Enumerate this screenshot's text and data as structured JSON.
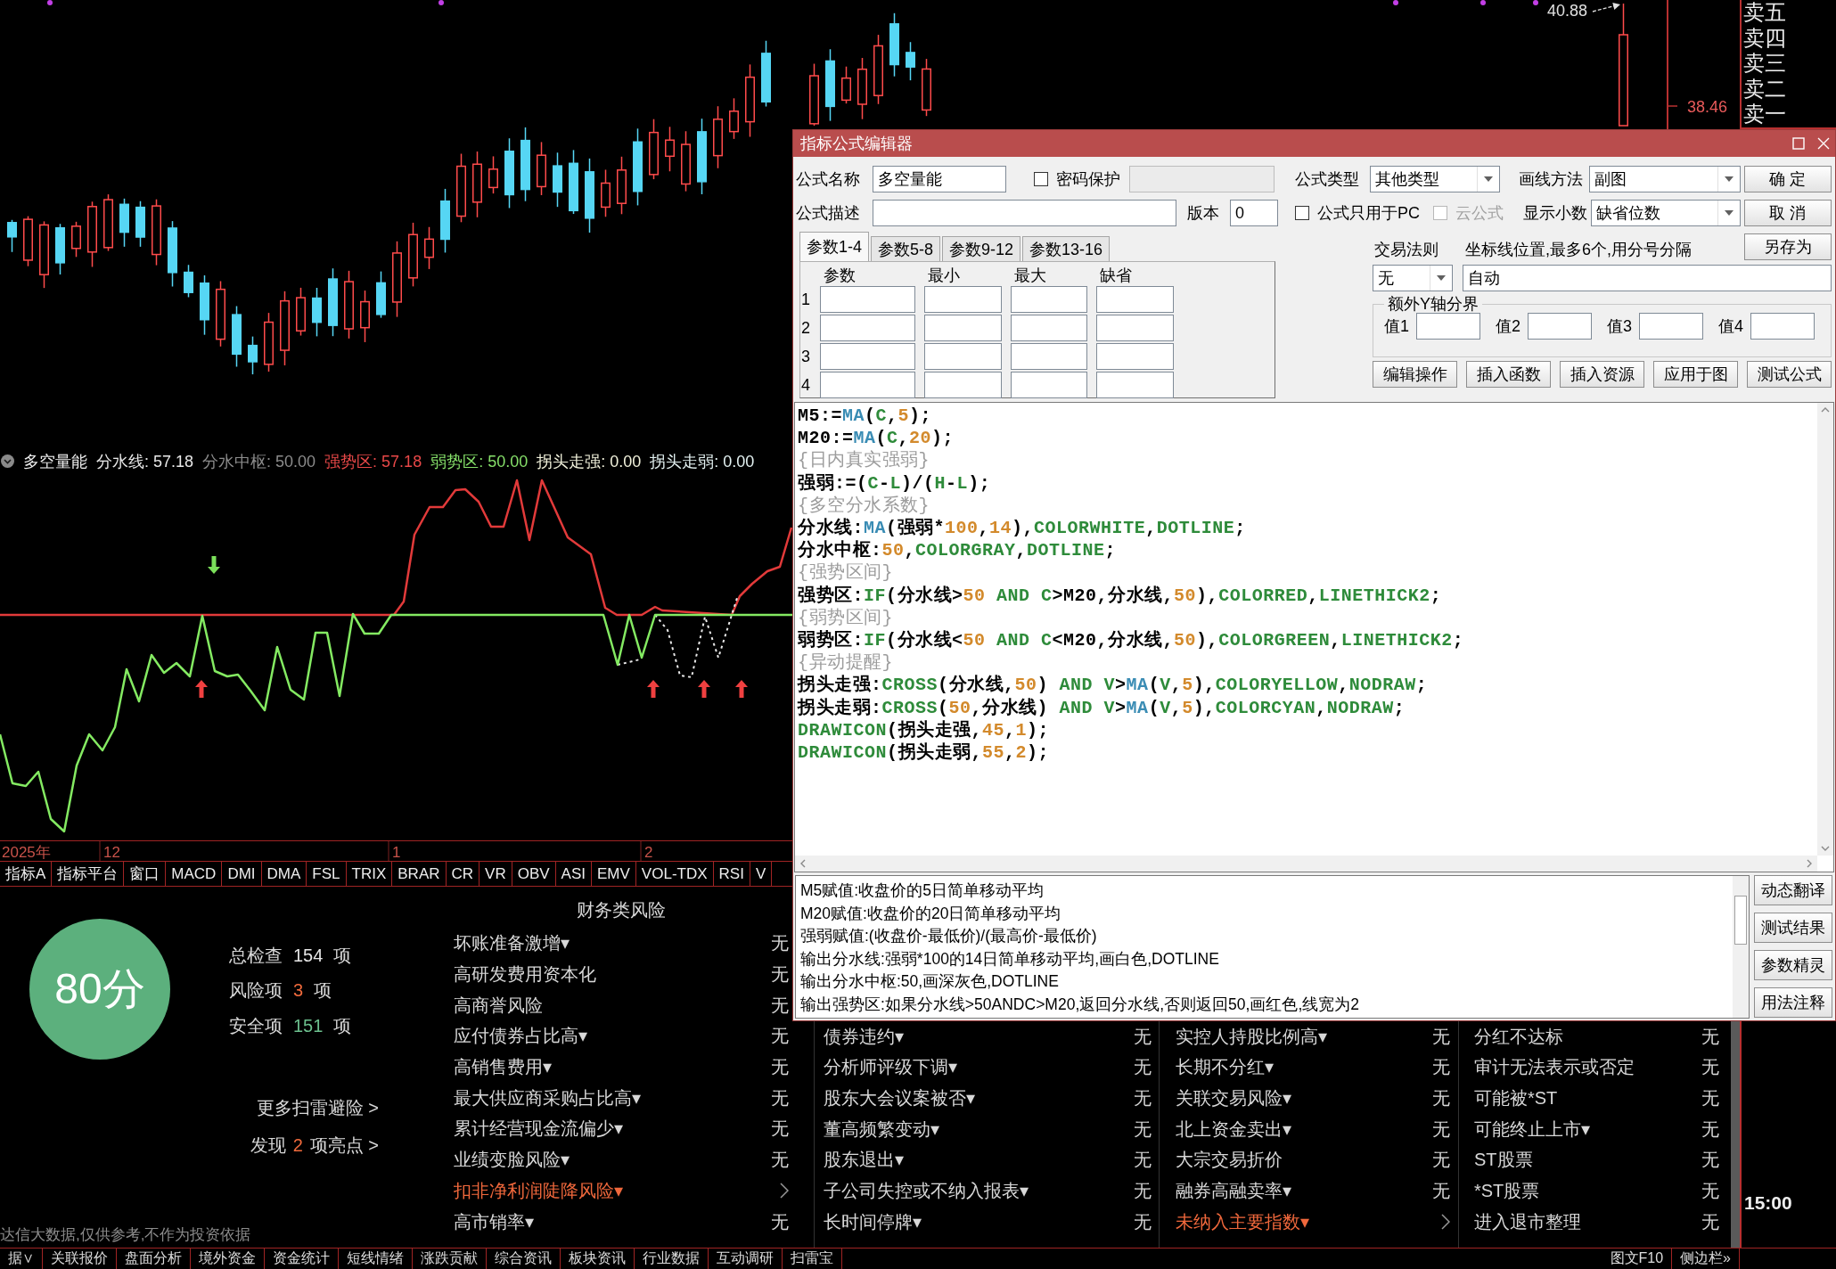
{
  "main_chart": {
    "high_label": "40.88",
    "axis_label": "38.46"
  },
  "order_book": [
    "卖五",
    "卖四",
    "卖三",
    "卖二",
    "卖一"
  ],
  "indicator": {
    "name": "多空量能",
    "outputs": [
      {
        "text": "分水线: 57.18",
        "color": "#e8e8e8"
      },
      {
        "text": "分水中枢: 50.00",
        "color": "#8c8c8c"
      },
      {
        "text": "强势区: 57.18",
        "color": "#e84848"
      },
      {
        "text": "弱势区: 50.00",
        "color": "#86e06a"
      },
      {
        "text": "拐头走强: 0.00",
        "color": "#f2f2dc"
      },
      {
        "text": "拐头走弱: 0.00",
        "color": "#e4f2f2"
      }
    ]
  },
  "time_axis": [
    "2025年",
    "12",
    "1",
    "2"
  ],
  "indicator_tabs": [
    "指标A",
    "指标平台",
    "窗口",
    "MACD",
    "DMI",
    "DMA",
    "FSL",
    "TRIX",
    "BRAR",
    "CR",
    "VR",
    "OBV",
    "ASI",
    "EMV",
    "VOL-TDX",
    "RSI",
    "V"
  ],
  "risk_panel": {
    "score": "80分",
    "stats": [
      {
        "label": "总检查",
        "count": "154",
        "unit": "项",
        "color": "#e6e6e6"
      },
      {
        "label": "风险项",
        "count": "3",
        "unit": "项",
        "color": "#f06a3c"
      },
      {
        "label": "安全项",
        "count": "151",
        "unit": "项",
        "color": "#6cc08e"
      }
    ],
    "links": [
      {
        "text": "更多扫雷避险 >"
      },
      {
        "text": "发现",
        "count": "2",
        "suffix": "项亮点 >"
      }
    ],
    "footer": "达信大数据,仅供参考,不作为投资依据",
    "columns": [
      {
        "title": "财务类风险",
        "items": [
          {
            "label": "坏账准备激增▾",
            "value": "无",
            "flagged": false
          },
          {
            "label": "高研发费用资本化",
            "value": "无",
            "flagged": false
          },
          {
            "label": "高商誉风险",
            "value": "无",
            "flagged": false
          },
          {
            "label": "应付债券占比高▾",
            "value": "无",
            "flagged": false
          },
          {
            "label": "高销售费用▾",
            "value": "无",
            "flagged": false
          },
          {
            "label": "最大供应商采购占比高▾",
            "value": "无",
            "flagged": false
          },
          {
            "label": "累计经营现金流偏少▾",
            "value": "无",
            "flagged": false
          },
          {
            "label": "业绩变脸风险▾",
            "value": "无",
            "flagged": false
          },
          {
            "label": "扣非净利润陡降风险▾",
            "flagged": true
          },
          {
            "label": "高市销率▾",
            "value": "无",
            "flagged": false
          }
        ]
      },
      {
        "items": [
          {
            "label": "债券违约▾",
            "value": "无",
            "flagged": false
          },
          {
            "label": "分析师评级下调▾",
            "value": "无",
            "flagged": false
          },
          {
            "label": "股东大会议案被否▾",
            "value": "无",
            "flagged": false
          },
          {
            "label": "董高频繁变动▾",
            "value": "无",
            "flagged": false
          },
          {
            "label": "股东退出▾",
            "value": "无",
            "flagged": false
          },
          {
            "label": "子公司失控或不纳入报表▾",
            "value": "无",
            "flagged": false
          },
          {
            "label": "长时间停牌▾",
            "value": "无",
            "flagged": false
          }
        ]
      },
      {
        "items": [
          {
            "label": "实控人持股比例高▾",
            "value": "无",
            "flagged": false
          },
          {
            "label": "长期不分红▾",
            "value": "无",
            "flagged": false
          },
          {
            "label": "关联交易风险▾",
            "value": "无",
            "flagged": false
          },
          {
            "label": "北上资金卖出▾",
            "value": "无",
            "flagged": false
          },
          {
            "label": "大宗交易折价",
            "value": "无",
            "flagged": false
          },
          {
            "label": "融券高融卖率▾",
            "value": "无",
            "flagged": false
          },
          {
            "label": "未纳入主要指数▾",
            "flagged": true
          }
        ]
      },
      {
        "items": [
          {
            "label": "分红不达标",
            "value": "无",
            "flagged": false
          },
          {
            "label": "审计无法表示或否定",
            "value": "无",
            "flagged": false
          },
          {
            "label": "可能被*ST",
            "value": "无",
            "flagged": false
          },
          {
            "label": "可能终止上市▾",
            "value": "无",
            "flagged": false
          },
          {
            "label": "ST股票",
            "value": "无",
            "flagged": false
          },
          {
            "label": "*ST股票",
            "value": "无",
            "flagged": false
          },
          {
            "label": "进入退市整理",
            "value": "无",
            "flagged": false
          }
        ]
      }
    ]
  },
  "side_panel": {
    "time": "15:00"
  },
  "bottom_tabs": [
    "据∨",
    "关联报价",
    "盘面分析",
    "境外资金",
    "资金统计",
    "短线情绪",
    "涨跌贡献",
    "综合资讯",
    "板块资讯",
    "行业数据",
    "互动调研",
    "扫雷宝"
  ],
  "bottom_right_tabs": [
    "图文F10",
    "侧边栏»"
  ],
  "dialog": {
    "title": "指标公式编辑器",
    "name_field": {
      "label": "公式名称",
      "value": "多空量能"
    },
    "password": {
      "label": "密码保护",
      "checked": false,
      "field_disabled": true
    },
    "formula_type": {
      "label": "公式类型",
      "value": "其他类型"
    },
    "draw_method": {
      "label": "画线方法",
      "value": "副图"
    },
    "description_field": {
      "label": "公式描述"
    },
    "version_field": {
      "label": "版本",
      "value": "0"
    },
    "options": [
      {
        "label": "公式只用于PC",
        "checked": false,
        "disabled": false
      },
      {
        "label": "云公式",
        "checked": false,
        "disabled": true
      }
    ],
    "decimals": {
      "label": "显示小数",
      "value": "缺省位数"
    },
    "buttons": [
      "确 定",
      "取 消",
      "另存为"
    ],
    "param_tabs": [
      {
        "label": "参数1-4",
        "selected": true
      },
      {
        "label": "参数5-8",
        "selected": false
      },
      {
        "label": "参数9-12",
        "selected": false
      },
      {
        "label": "参数13-16",
        "selected": false
      }
    ],
    "param_table": {
      "columns": [
        "参数",
        "最小",
        "最大",
        "缺省"
      ],
      "rows": [
        "1",
        "2",
        "3",
        "4"
      ]
    },
    "trade_rule": {
      "label": "交易法则",
      "value": "无"
    },
    "axis_lines": {
      "label": "坐标线位置,最多6个,用分号分隔",
      "value": "自动"
    },
    "y_bounds": {
      "title": "额外Y轴分界",
      "fields": [
        "值1",
        "值2",
        "值3",
        "值4"
      ]
    },
    "actions": [
      "编辑操作",
      "插入函数",
      "插入资源",
      "应用于图",
      "测试公式"
    ],
    "code": [
      [
        {
          "kind": "plain",
          "text": "M5:="
        },
        {
          "kind": "function",
          "text": "MA"
        },
        {
          "kind": "plain",
          "text": "("
        },
        {
          "kind": "keyword",
          "text": "C"
        },
        {
          "kind": "plain",
          "text": ","
        },
        {
          "kind": "number",
          "text": "5"
        },
        {
          "kind": "plain",
          "text": ");"
        }
      ],
      [
        {
          "kind": "plain",
          "text": "M20:="
        },
        {
          "kind": "function",
          "text": "MA"
        },
        {
          "kind": "plain",
          "text": "("
        },
        {
          "kind": "keyword",
          "text": "C"
        },
        {
          "kind": "plain",
          "text": ","
        },
        {
          "kind": "number",
          "text": "20"
        },
        {
          "kind": "plain",
          "text": ");"
        }
      ],
      [
        {
          "kind": "comment",
          "text": "{日内真实强弱}"
        }
      ],
      [
        {
          "kind": "plain",
          "text": "强弱:=("
        },
        {
          "kind": "keyword",
          "text": "C"
        },
        {
          "kind": "plain",
          "text": "-"
        },
        {
          "kind": "keyword",
          "text": "L"
        },
        {
          "kind": "plain",
          "text": ")/("
        },
        {
          "kind": "keyword",
          "text": "H"
        },
        {
          "kind": "plain",
          "text": "-"
        },
        {
          "kind": "keyword",
          "text": "L"
        },
        {
          "kind": "plain",
          "text": ");"
        }
      ],
      [
        {
          "kind": "comment",
          "text": "{多空分水系数}"
        }
      ],
      [
        {
          "kind": "plain",
          "text": "分水线:"
        },
        {
          "kind": "function",
          "text": "MA"
        },
        {
          "kind": "plain",
          "text": "(强弱*"
        },
        {
          "kind": "number",
          "text": "100"
        },
        {
          "kind": "plain",
          "text": ","
        },
        {
          "kind": "number",
          "text": "14"
        },
        {
          "kind": "plain",
          "text": "),"
        },
        {
          "kind": "keyword",
          "text": "COLORWHITE"
        },
        {
          "kind": "plain",
          "text": ","
        },
        {
          "kind": "keyword",
          "text": "DOTLINE"
        },
        {
          "kind": "plain",
          "text": ";"
        }
      ],
      [
        {
          "kind": "plain",
          "text": "分水中枢:"
        },
        {
          "kind": "number",
          "text": "50"
        },
        {
          "kind": "plain",
          "text": ","
        },
        {
          "kind": "keyword",
          "text": "COLORGRAY"
        },
        {
          "kind": "plain",
          "text": ","
        },
        {
          "kind": "keyword",
          "text": "DOTLINE"
        },
        {
          "kind": "plain",
          "text": ";"
        }
      ],
      [
        {
          "kind": "comment",
          "text": "{强势区间}"
        }
      ],
      [
        {
          "kind": "plain",
          "text": "强势区:"
        },
        {
          "kind": "keyword",
          "text": "IF"
        },
        {
          "kind": "plain",
          "text": "(分水线>"
        },
        {
          "kind": "number",
          "text": "50"
        },
        {
          "kind": "keyword",
          "text": " AND C"
        },
        {
          "kind": "plain",
          "text": ">M20,分水线,"
        },
        {
          "kind": "number",
          "text": "50"
        },
        {
          "kind": "plain",
          "text": "),"
        },
        {
          "kind": "keyword",
          "text": "COLORRED"
        },
        {
          "kind": "plain",
          "text": ","
        },
        {
          "kind": "keyword",
          "text": "LINETHICK2"
        },
        {
          "kind": "plain",
          "text": ";"
        }
      ],
      [
        {
          "kind": "comment",
          "text": "{弱势区间}"
        }
      ],
      [
        {
          "kind": "plain",
          "text": "弱势区:"
        },
        {
          "kind": "keyword",
          "text": "IF"
        },
        {
          "kind": "plain",
          "text": "(分水线<"
        },
        {
          "kind": "number",
          "text": "50"
        },
        {
          "kind": "keyword",
          "text": " AND C"
        },
        {
          "kind": "plain",
          "text": "<M20,分水线,"
        },
        {
          "kind": "number",
          "text": "50"
        },
        {
          "kind": "plain",
          "text": "),"
        },
        {
          "kind": "keyword",
          "text": "COLORGREEN"
        },
        {
          "kind": "plain",
          "text": ","
        },
        {
          "kind": "keyword",
          "text": "LINETHICK2"
        },
        {
          "kind": "plain",
          "text": ";"
        }
      ],
      [
        {
          "kind": "comment",
          "text": "{异动提醒}"
        }
      ],
      [
        {
          "kind": "plain",
          "text": "拐头走强:"
        },
        {
          "kind": "keyword",
          "text": "CROSS"
        },
        {
          "kind": "plain",
          "text": "(分水线,"
        },
        {
          "kind": "number",
          "text": "50"
        },
        {
          "kind": "plain",
          "text": ")"
        },
        {
          "kind": "keyword",
          "text": " AND V"
        },
        {
          "kind": "plain",
          "text": ">"
        },
        {
          "kind": "function",
          "text": "MA"
        },
        {
          "kind": "plain",
          "text": "("
        },
        {
          "kind": "keyword",
          "text": "V"
        },
        {
          "kind": "plain",
          "text": ","
        },
        {
          "kind": "number",
          "text": "5"
        },
        {
          "kind": "plain",
          "text": "),"
        },
        {
          "kind": "keyword",
          "text": "COLORYELLOW"
        },
        {
          "kind": "plain",
          "text": ","
        },
        {
          "kind": "keyword",
          "text": "NODRAW"
        },
        {
          "kind": "plain",
          "text": ";"
        }
      ],
      [
        {
          "kind": "plain",
          "text": "拐头走弱:"
        },
        {
          "kind": "keyword",
          "text": "CROSS"
        },
        {
          "kind": "plain",
          "text": "("
        },
        {
          "kind": "number",
          "text": "50"
        },
        {
          "kind": "plain",
          "text": ",分水线)"
        },
        {
          "kind": "keyword",
          "text": " AND V"
        },
        {
          "kind": "plain",
          "text": ">"
        },
        {
          "kind": "function",
          "text": "MA"
        },
        {
          "kind": "plain",
          "text": "("
        },
        {
          "kind": "keyword",
          "text": "V"
        },
        {
          "kind": "plain",
          "text": ","
        },
        {
          "kind": "number",
          "text": "5"
        },
        {
          "kind": "plain",
          "text": "),"
        },
        {
          "kind": "keyword",
          "text": "COLORCYAN"
        },
        {
          "kind": "plain",
          "text": ","
        },
        {
          "kind": "keyword",
          "text": "NODRAW"
        },
        {
          "kind": "plain",
          "text": ";"
        }
      ],
      [
        {
          "kind": "keyword",
          "text": "DRAWICON"
        },
        {
          "kind": "plain",
          "text": "(拐头走强,"
        },
        {
          "kind": "number",
          "text": "45"
        },
        {
          "kind": "plain",
          "text": ","
        },
        {
          "kind": "number",
          "text": "1"
        },
        {
          "kind": "plain",
          "text": ");"
        }
      ],
      [
        {
          "kind": "keyword",
          "text": "DRAWICON"
        },
        {
          "kind": "plain",
          "text": "(拐头走弱,"
        },
        {
          "kind": "number",
          "text": "55"
        },
        {
          "kind": "plain",
          "text": ","
        },
        {
          "kind": "number",
          "text": "2"
        },
        {
          "kind": "plain",
          "text": ");"
        }
      ]
    ],
    "explanation": [
      "M5赋值:收盘价的5日简单移动平均",
      "M20赋值:收盘价的20日简单移动平均",
      "强弱赋值:(收盘价-最低价)/(最高价-最低价)",
      "输出分水线:强弱*100的14日简单移动平均,画白色,DOTLINE",
      "输出分水中枢:50,画深灰色,DOTLINE",
      "输出强势区:如果分水线>50ANDC>M20,返回分水线,否则返回50,画红色,线宽为2"
    ],
    "explain_buttons": [
      "动态翻译",
      "测试结果",
      "参数精灵",
      "用法注释"
    ]
  }
}
